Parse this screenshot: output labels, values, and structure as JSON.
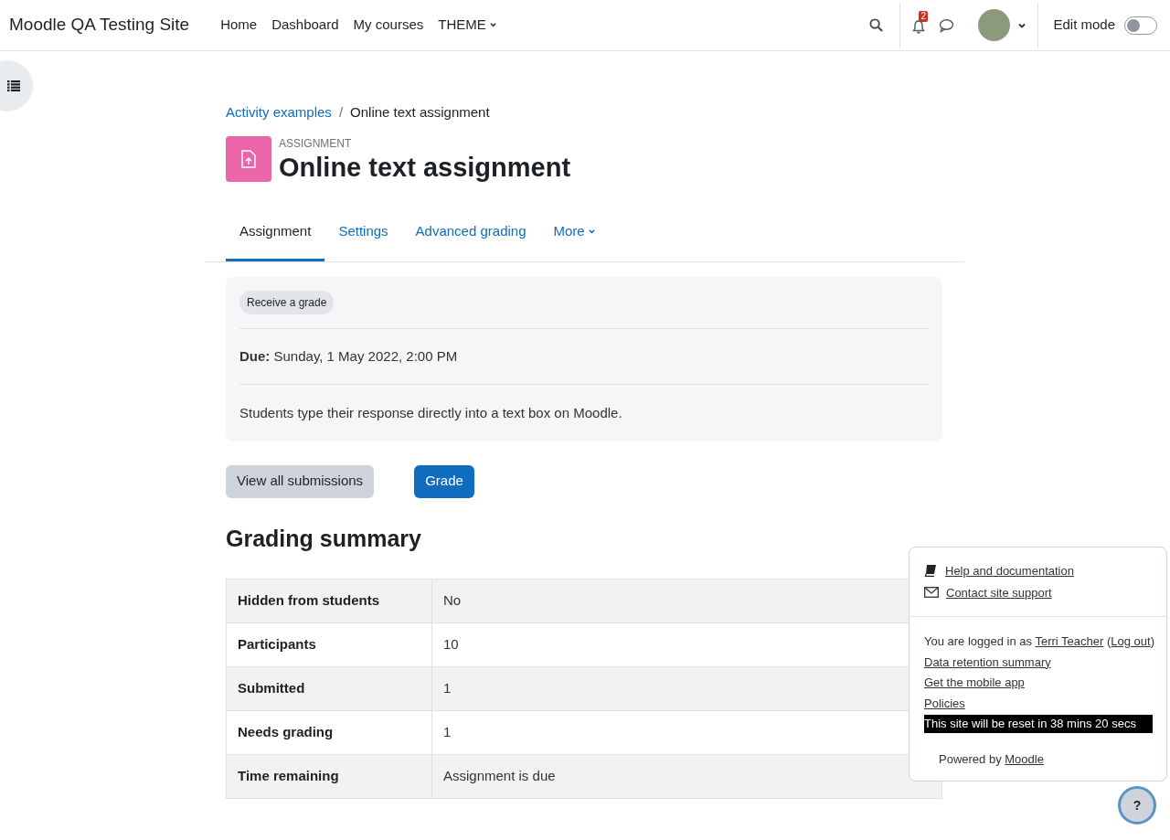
{
  "navbar": {
    "site_name": "Moodle QA Testing Site",
    "links": [
      {
        "label": "Home",
        "dropdown": false
      },
      {
        "label": "Dashboard",
        "dropdown": false
      },
      {
        "label": "My courses",
        "dropdown": false
      },
      {
        "label": "THEME",
        "dropdown": true
      }
    ],
    "notification_count": "2",
    "edit_mode": {
      "label": "Edit mode",
      "on": false
    }
  },
  "breadcrumb_separator": "/",
  "breadcrumb": [
    {
      "label": "Activity examples",
      "link": true
    },
    {
      "label": "Online text assignment",
      "link": false
    }
  ],
  "header": {
    "kind_label": "ASSIGNMENT",
    "title": "Online text assignment"
  },
  "tabs": [
    {
      "label": "Assignment",
      "selected": true,
      "dropdown": false
    },
    {
      "label": "Settings",
      "selected": false,
      "dropdown": false
    },
    {
      "label": "Advanced grading",
      "selected": false,
      "dropdown": false
    },
    {
      "label": "More",
      "selected": false,
      "dropdown": true
    }
  ],
  "activity_info": {
    "badge": "Receive a grade",
    "due": "**Due:** Sunday, 1 May 2022, 2:00 PM",
    "description": "Students type their response directly into a text box on Moodle."
  },
  "buttons": [
    {
      "label": "View all submissions",
      "kind": "secondary"
    },
    {
      "label": "Grade",
      "kind": "primary"
    }
  ],
  "grading_summary": {
    "heading": "Grading summary",
    "rows": [
      {
        "label": "Hidden from students",
        "value": "No"
      },
      {
        "label": "Participants",
        "value": "10"
      },
      {
        "label": "Submitted",
        "value": "1"
      },
      {
        "label": "Needs grading",
        "value": "1"
      },
      {
        "label": "Time remaining",
        "value": "Assignment is due"
      }
    ]
  },
  "footer_popover": {
    "links": [
      "Help and documentation",
      "Contact site support"
    ],
    "login_line": {
      "prefix": "You are logged in as ",
      "user_link": "Terri Teacher",
      "open_paren": " (",
      "logout_link": "Log out",
      "close_paren": ")"
    },
    "other_links": [
      "Data retention summary",
      "Get the mobile app",
      "Policies"
    ],
    "reset_notice": "This site will be reset in 38 mins 20 secs",
    "powered_by": {
      "prefix": "Powered by ",
      "link": "Moodle"
    },
    "help_button": "?"
  }
}
